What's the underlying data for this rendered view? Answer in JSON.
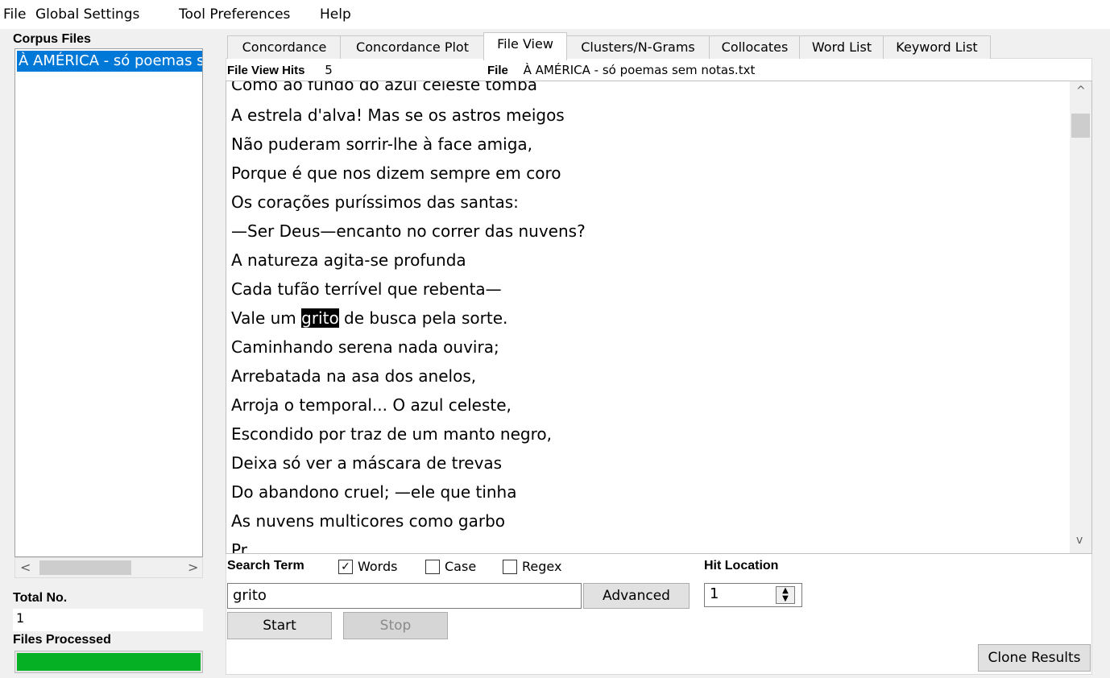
{
  "menu": [
    "File",
    "Global Settings",
    "Tool Preferences",
    "Help"
  ],
  "left": {
    "corpus_files_label": "Corpus Files",
    "selected_file": "À AMÉRICA - só poemas sem notas.txt",
    "scroll_left": "<",
    "scroll_right": ">",
    "total_label": "Total No.",
    "total_value": "1",
    "files_processed_label": "Files Processed",
    "progress": 1.0,
    "progress_color": "#06b025"
  },
  "tabs": [
    "Concordance",
    "Concordance Plot",
    "File View",
    "Clusters/N-Grams",
    "Collocates",
    "Word List",
    "Keyword List"
  ],
  "active_tab": "File View",
  "file_view": {
    "hits_label": "File View Hits",
    "hits_value": "5",
    "file_label": "File",
    "file_value": "À AMÉRICA - só poemas sem notas.txt",
    "lines": [
      "Como ao fundo do azul celeste tomba",
      "A estrela d'alva! Mas se os astros meigos",
      "Não puderam sorrir-lhe à face amiga,",
      "Porque é que nos dizem sempre em coro",
      "Os corações puríssimos das santas:",
      "—Ser Deus—encanto no correr das nuvens?",
      "A natureza agita-se profunda",
      "Cada tufão terrível que rebenta—",
      "Caminhando serena nada ouvira;",
      "Arrebatada na asa dos anelos,",
      "Arroja o temporal... O azul celeste,",
      "Escondido por traz de um manto negro,",
      "Deixa só ver a máscara de trevas",
      "Do abandono cruel; —ele que tinha",
      "As nuvens multicores como garbo",
      "Pr... ... ... ... ... ... ..."
    ],
    "hit_line_before": "Vale um ",
    "hit_word": "grito",
    "hit_line_after": " de busca pela sorte.",
    "scroll_up": "^",
    "scroll_down": "v"
  },
  "search": {
    "label": "Search Term",
    "words_label": "Words",
    "words_checked": true,
    "case_label": "Case",
    "case_checked": false,
    "regex_label": "Regex",
    "regex_checked": false,
    "term": "grito",
    "advanced": "Advanced",
    "hit_location_label": "Hit Location",
    "hit_location_value": "1",
    "start": "Start",
    "stop": "Stop",
    "clone": "Clone Results"
  }
}
